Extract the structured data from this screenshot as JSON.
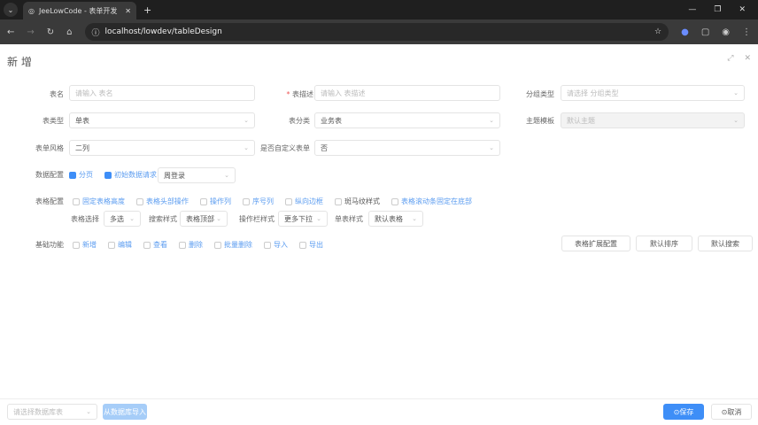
{
  "browser": {
    "tab_title": "JeeLowCode - 表单开发",
    "url": "localhost/lowdev/tableDesign"
  },
  "dialog": {
    "title": "新 增"
  },
  "form": {
    "table_name": {
      "label": "表名",
      "placeholder": "请输入 表名"
    },
    "table_desc": {
      "label": "表描述",
      "placeholder": "请输入 表描述"
    },
    "group_type": {
      "label": "分组类型",
      "placeholder": "请选择 分组类型"
    },
    "table_type": {
      "label": "表类型",
      "value": "单表"
    },
    "table_category": {
      "label": "表分类",
      "value": "业务表"
    },
    "theme": {
      "label": "主题模板",
      "value": "默认主题"
    },
    "form_style": {
      "label": "表单风格",
      "value": "二列"
    },
    "custom_form": {
      "label": "是否自定义表单",
      "value": "否"
    },
    "data_config": {
      "label": "数据配置",
      "options": [
        {
          "label": "分页",
          "checked": true
        },
        {
          "label": "初始数据请求",
          "checked": true
        }
      ],
      "select": "周登录"
    },
    "table_config": {
      "label": "表格配置",
      "options": [
        {
          "label": "固定表格高度",
          "active": true
        },
        {
          "label": "表格头部操作",
          "active": true
        },
        {
          "label": "操作列",
          "active": true
        },
        {
          "label": "序号列",
          "active": true
        },
        {
          "label": "纵向边框",
          "active": true
        },
        {
          "label": "斑马纹样式",
          "active": false
        },
        {
          "label": "表格滚动条固定在底部",
          "active": true
        }
      ]
    },
    "selects": [
      {
        "label": "表格选择",
        "value": "多选"
      },
      {
        "label": "搜索样式",
        "value": "表格顶部"
      },
      {
        "label": "操作栏样式",
        "value": "更多下拉"
      },
      {
        "label": "单表样式",
        "value": "默认表格"
      }
    ],
    "basic": {
      "label": "基础功能",
      "options": [
        "新增",
        "编辑",
        "查看",
        "删除",
        "批量删除",
        "导入",
        "导出"
      ]
    },
    "buttons": {
      "ext": "表格扩展配置",
      "sort": "默认排序",
      "search": "默认搜索"
    }
  },
  "footer": {
    "db_placeholder": "请选择数据库表",
    "import": "从数据库导入",
    "save": "保存",
    "cancel": "取消"
  },
  "colors": {
    "primary": "#3e8ef7"
  }
}
